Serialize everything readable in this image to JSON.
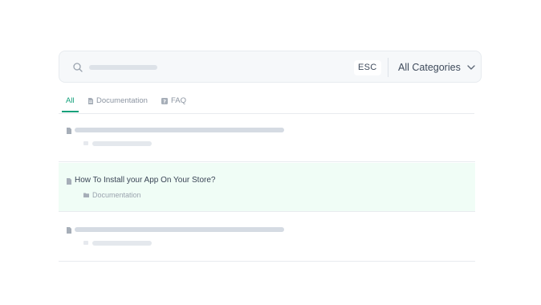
{
  "search": {
    "esc_label": "ESC",
    "category_select": "All Categories"
  },
  "tabs": [
    {
      "label": "All",
      "active": true
    },
    {
      "label": "Documentation",
      "icon": "document-icon"
    },
    {
      "label": "FAQ",
      "icon": "faq-icon"
    }
  ],
  "results": [
    {
      "loading": true
    },
    {
      "title": "How To Install your App On Your Store?",
      "category": "Documentation",
      "highlighted": true
    },
    {
      "loading": true
    }
  ],
  "colors": {
    "accent": "#12a07a",
    "highlight_bg": "#f0fdf6",
    "skeleton": "#d5dbe3"
  }
}
